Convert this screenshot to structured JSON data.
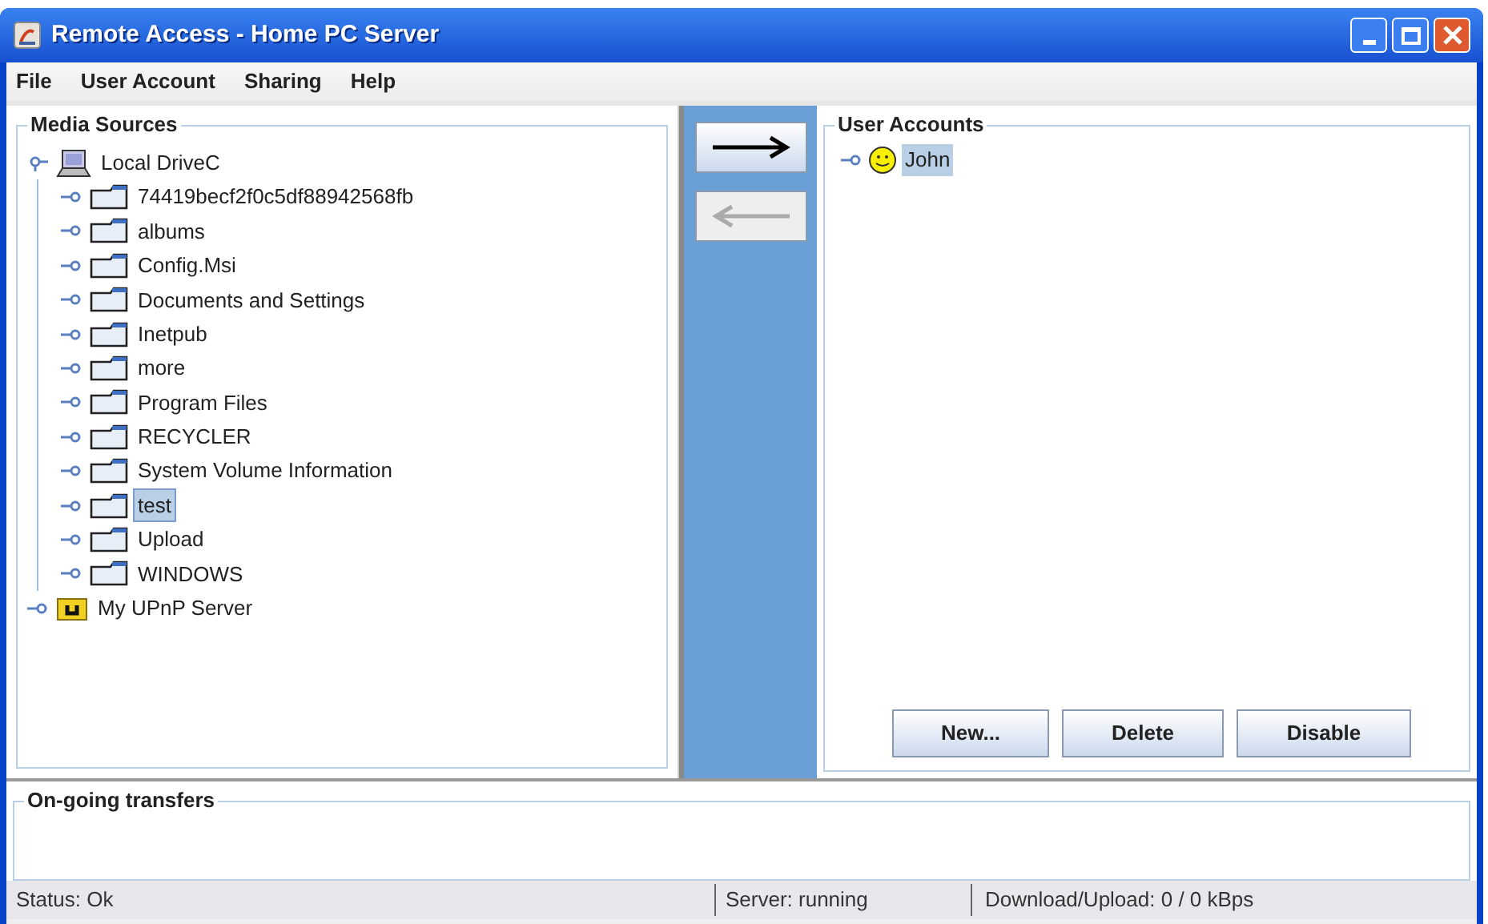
{
  "window": {
    "title": "Remote Access - Home PC Server"
  },
  "menu": [
    "File",
    "User Account",
    "Sharing",
    "Help"
  ],
  "media_sources": {
    "title": "Media Sources",
    "tree": [
      {
        "label": "Local DriveC",
        "kind": "drive",
        "expanded": true,
        "selected": false,
        "children": [
          {
            "label": "74419becf2f0c5df88942568fb",
            "kind": "folder",
            "expanded": false,
            "selected": false
          },
          {
            "label": "albums",
            "kind": "folder",
            "expanded": false,
            "selected": false
          },
          {
            "label": "Config.Msi",
            "kind": "folder",
            "expanded": false,
            "selected": false
          },
          {
            "label": "Documents and Settings",
            "kind": "folder",
            "expanded": false,
            "selected": false
          },
          {
            "label": "Inetpub",
            "kind": "folder",
            "expanded": false,
            "selected": false
          },
          {
            "label": "more",
            "kind": "folder",
            "expanded": false,
            "selected": false
          },
          {
            "label": "Program Files",
            "kind": "folder",
            "expanded": false,
            "selected": false
          },
          {
            "label": "RECYCLER",
            "kind": "folder",
            "expanded": false,
            "selected": false
          },
          {
            "label": "System Volume Information",
            "kind": "folder",
            "expanded": false,
            "selected": false
          },
          {
            "label": "test",
            "kind": "folder",
            "expanded": false,
            "selected": true
          },
          {
            "label": "Upload",
            "kind": "folder",
            "expanded": false,
            "selected": false
          },
          {
            "label": "WINDOWS",
            "kind": "folder",
            "expanded": false,
            "selected": false
          }
        ]
      },
      {
        "label": "My UPnP Server",
        "kind": "server",
        "expanded": false,
        "selected": false
      }
    ]
  },
  "transfer_buttons": [
    {
      "kind": "right",
      "disabled": false
    },
    {
      "kind": "left",
      "disabled": true
    }
  ],
  "user_accounts": {
    "title": "User Accounts",
    "users": [
      {
        "label": "John",
        "expanded": false,
        "selected": true
      }
    ],
    "buttons": [
      "New...",
      "Delete",
      "Disable"
    ]
  },
  "transfers": {
    "title": "On-going transfers"
  },
  "status_bar": [
    "Status: Ok",
    "Server: running",
    "Download/Upload: 0 / 0 kBps"
  ]
}
